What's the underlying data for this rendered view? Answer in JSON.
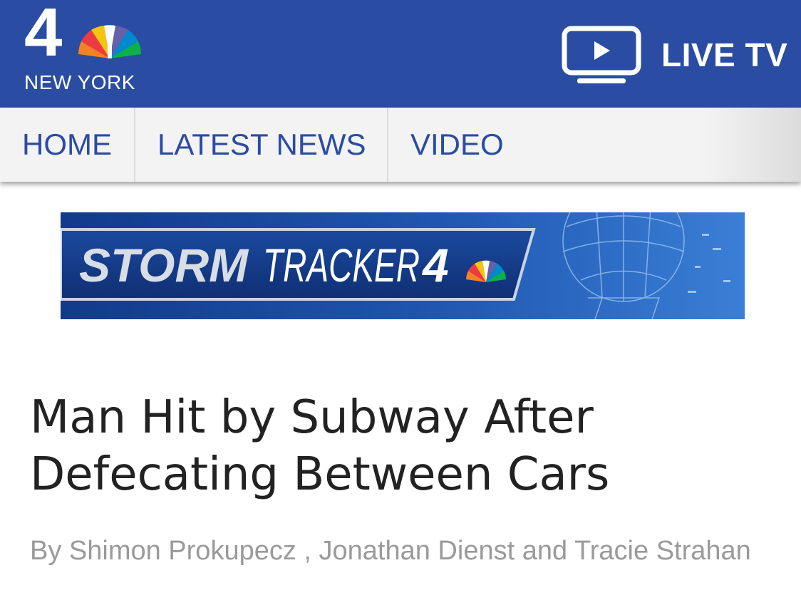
{
  "header": {
    "logo": {
      "number": "4",
      "subtitle": "NEW YORK",
      "icon": "nbc-peacock-icon"
    },
    "live_tv": {
      "label": "LIVE TV",
      "icon": "play-tv-icon"
    },
    "colors": {
      "brand_blue": "#2a4ca2",
      "white": "#ffffff"
    }
  },
  "nav": {
    "items": [
      {
        "label": "HOME"
      },
      {
        "label": "LATEST NEWS"
      },
      {
        "label": "VIDEO"
      }
    ],
    "colors": {
      "text": "#2a4ca2",
      "background": "#f3f3f3"
    }
  },
  "banner": {
    "brand_bold": "STORM",
    "brand_light": "TRACKER",
    "brand_number": "4",
    "icon": "nbc-peacock-icon"
  },
  "article": {
    "headline": "Man Hit by Subway After Defecating Between Cars",
    "byline": "By Shimon Prokupecz , Jonathan Dienst and Tracie Strahan",
    "colors": {
      "headline": "#222222",
      "byline": "#9a9a9a"
    }
  }
}
